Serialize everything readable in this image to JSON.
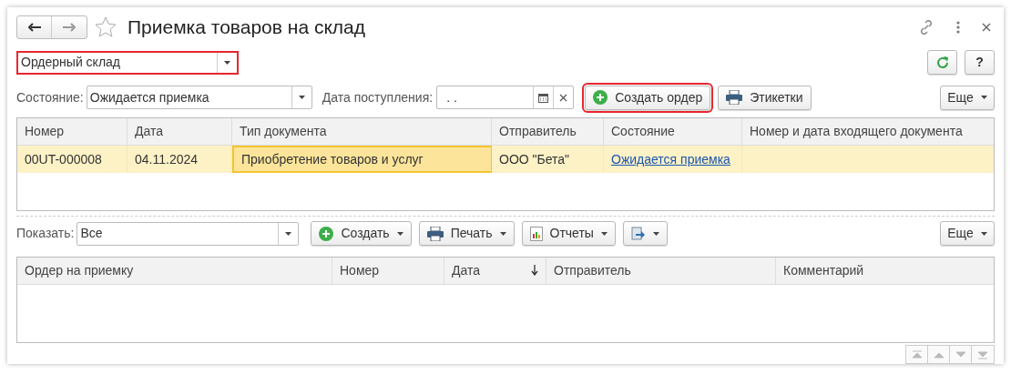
{
  "window": {
    "title": "Приемка товаров на склад",
    "favorite": false
  },
  "warehouse": {
    "value": "Ордерный склад",
    "highlighted": true
  },
  "filter": {
    "state_label": "Состояние:",
    "state_value": "Ожидается приемка",
    "date_label": "Дата поступления:",
    "date_value": ". ."
  },
  "top_buttons": [
    {
      "kind": "create",
      "label": "Создать ордер",
      "highlighted": true
    },
    {
      "kind": "print",
      "label": "Этикетки",
      "highlighted": false
    }
  ],
  "top_more": "Еще",
  "documents": {
    "columns": [
      {
        "label": "Номер"
      },
      {
        "label": "Дата"
      },
      {
        "label": "Тип документа"
      },
      {
        "label": "Отправитель"
      },
      {
        "label": "Состояние"
      },
      {
        "label": "Номер и дата входящего документа"
      }
    ],
    "rows": [
      {
        "selected": true,
        "cells": [
          {
            "kind": "text",
            "text": "00UT-000008",
            "focused": false
          },
          {
            "kind": "text",
            "text": "04.11.2024",
            "focused": false
          },
          {
            "kind": "text",
            "text": "Приобретение товаров и услуг",
            "focused": true
          },
          {
            "kind": "text",
            "text": "ООО \"Бета\"",
            "focused": false
          },
          {
            "kind": "link",
            "text": "Ожидается приемка",
            "focused": false
          }
        ]
      }
    ]
  },
  "show": {
    "label": "Показать:",
    "value": "Все"
  },
  "bottom_buttons": [
    {
      "kind": "create",
      "label": "Создать"
    },
    {
      "kind": "print",
      "label": "Печать"
    },
    {
      "kind": "report",
      "label": "Отчеты"
    },
    {
      "kind": "export"
    }
  ],
  "bottom_more": "Еще",
  "orders": {
    "columns": [
      {
        "label": "Ордер на приемку",
        "sorted": false
      },
      {
        "label": "Номер",
        "sorted": false
      },
      {
        "label": "Дата",
        "sorted": true
      },
      {
        "label": "Отправитель",
        "sorted": false
      },
      {
        "label": "Комментарий",
        "sorted": false
      }
    ]
  },
  "help_label": "?"
}
